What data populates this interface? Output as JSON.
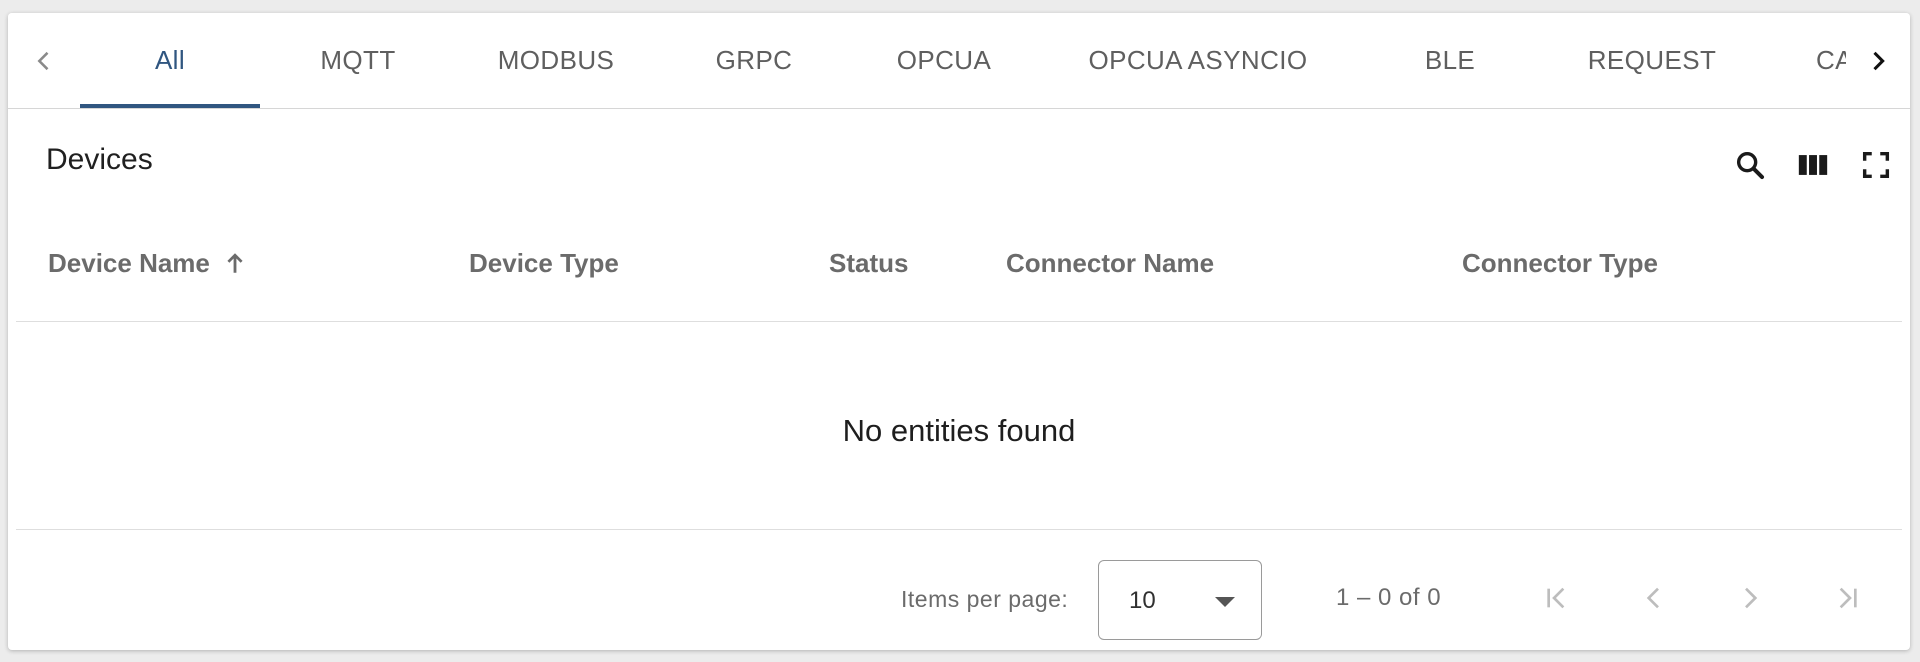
{
  "tabs": [
    {
      "label": "All",
      "active": true
    },
    {
      "label": "MQTT"
    },
    {
      "label": "MODBUS"
    },
    {
      "label": "GRPC"
    },
    {
      "label": "OPCUA"
    },
    {
      "label": "OPCUA ASYNCIO"
    },
    {
      "label": "BLE"
    },
    {
      "label": "REQUEST"
    },
    {
      "label": "CA"
    }
  ],
  "table": {
    "title": "Devices",
    "columns": [
      "Device Name",
      "Device Type",
      "Status",
      "Connector Name",
      "Connector Type"
    ],
    "sorted_column": "Device Name",
    "sort_direction": "ascending",
    "empty_message": "No entities found"
  },
  "toolbar": {
    "icons": [
      "search-icon",
      "columns-icon",
      "fullscreen-icon"
    ]
  },
  "paginator": {
    "items_per_page_label": "Items per page:",
    "items_per_page_value": "10",
    "range_label": "1 – 0 of 0",
    "icons": [
      "first-page-icon",
      "previous-page-icon",
      "next-page-icon",
      "last-page-icon"
    ]
  },
  "colors": {
    "accent": "#305680",
    "text_muted": "#6b6b6b",
    "disabled_icon": "#bdbdbd"
  }
}
